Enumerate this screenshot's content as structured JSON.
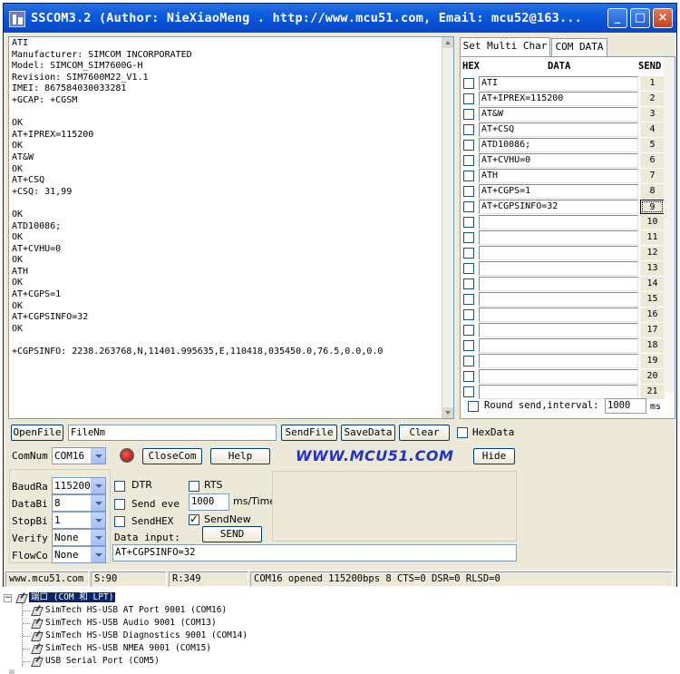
{
  "window": {
    "title": "SSCOM3.2 (Author: NieXiaoMeng .  http://www.mcu51.com,  Email: mcu52@163...",
    "minimize": "_",
    "maximize": "□",
    "close": "×"
  },
  "receive_text": "ATI\nManufacturer: SIMCOM INCORPORATED\nModel: SIMCOM_SIM7600G-H\nRevision: SIM7600M22_V1.1\nIMEI: 867584030033281\n+GCAP: +CGSM\n\nOK\nAT+IPREX=115200\nOK\nAT&W\nOK\nAT+CSQ\n+CSQ: 31,99\n\nOK\nATD10086;\nOK\nAT+CVHU=0\nOK\nATH\nOK\nAT+CGPS=1\nOK\nAT+CGPSINFO=32\nOK\n\n+CGPSINFO: 2238.263768,N,11401.995635,E,110418,035450.0,76.5,0.0,0.0",
  "tabs": [
    {
      "label": "Set Multi Char",
      "active": true
    },
    {
      "label": "COM DATA",
      "active": false
    }
  ],
  "multi_char": {
    "headers": {
      "hex": "HEX",
      "data": "DATA",
      "send": "SEND"
    },
    "rows": [
      {
        "data": "ATI",
        "send": "1"
      },
      {
        "data": "AT+IPREX=115200",
        "send": "2"
      },
      {
        "data": "AT&W",
        "send": "3"
      },
      {
        "data": "AT+CSQ",
        "send": "4"
      },
      {
        "data": "ATD10086;",
        "send": "5"
      },
      {
        "data": "AT+CVHU=0",
        "send": "6"
      },
      {
        "data": "ATH",
        "send": "7"
      },
      {
        "data": "AT+CGPS=1",
        "send": "8"
      },
      {
        "data": "AT+CGPSINFO=32",
        "send": "9"
      },
      {
        "data": "",
        "send": "10"
      },
      {
        "data": "",
        "send": "11"
      },
      {
        "data": "",
        "send": "12"
      },
      {
        "data": "",
        "send": "13"
      },
      {
        "data": "",
        "send": "14"
      },
      {
        "data": "",
        "send": "15"
      },
      {
        "data": "",
        "send": "16"
      },
      {
        "data": "",
        "send": "17"
      },
      {
        "data": "",
        "send": "18"
      },
      {
        "data": "",
        "send": "19"
      },
      {
        "data": "",
        "send": "20"
      },
      {
        "data": "",
        "send": "21"
      }
    ],
    "round_send_label": "Round send,interval:",
    "interval_value": "1000",
    "interval_unit": "ms"
  },
  "file_row": {
    "open_file": "OpenFile",
    "file_name": "FileNm",
    "send_file": "SendFile",
    "save_data": "SaveData",
    "clear": "Clear",
    "hex_data": "HexData"
  },
  "com_row": {
    "com_num_label": "ComNum",
    "com_num_value": "COM16",
    "close_com": "CloseCom",
    "help": "Help",
    "site": "WWW.MCU51.COM",
    "hide": "Hide"
  },
  "settings": {
    "baud_label": "BaudRa",
    "baud_value": "115200",
    "databits_label": "DataBi",
    "databits_value": "8",
    "stopbits_label": "StopBi",
    "stopbits_value": "1",
    "verify_label": "Verify",
    "verify_value": "None",
    "flow_label": "FlowCo",
    "flow_value": "None",
    "dtr": "DTR",
    "rts": "RTS",
    "send_every": "Send eve",
    "send_every_value": "1000",
    "send_every_unit": "ms/Time",
    "send_hex": "SendHEX",
    "send_new": "SendNew",
    "send_new_checked": true,
    "data_input_label": "Data input:",
    "send_button": "SEND",
    "data_input_value": "AT+CGPSINFO=32"
  },
  "status": {
    "site": "www.mcu51.com",
    "sent": "S:90",
    "received": "R:349",
    "port_state": "COM16 opened 115200bps  8 CTS=0 DSR=0 RLSD=0"
  },
  "device_tree": {
    "category": "端口 (COM 和 LPT)",
    "ports": [
      "SimTech HS-USB AT Port 9001 (COM16)",
      "SimTech HS-USB Audio 9001 (COM13)",
      "SimTech HS-USB Diagnostics 9001 (COM14)",
      "SimTech HS-USB NMEA 9001 (COM15)",
      "USB Serial Port (COM5)"
    ]
  }
}
